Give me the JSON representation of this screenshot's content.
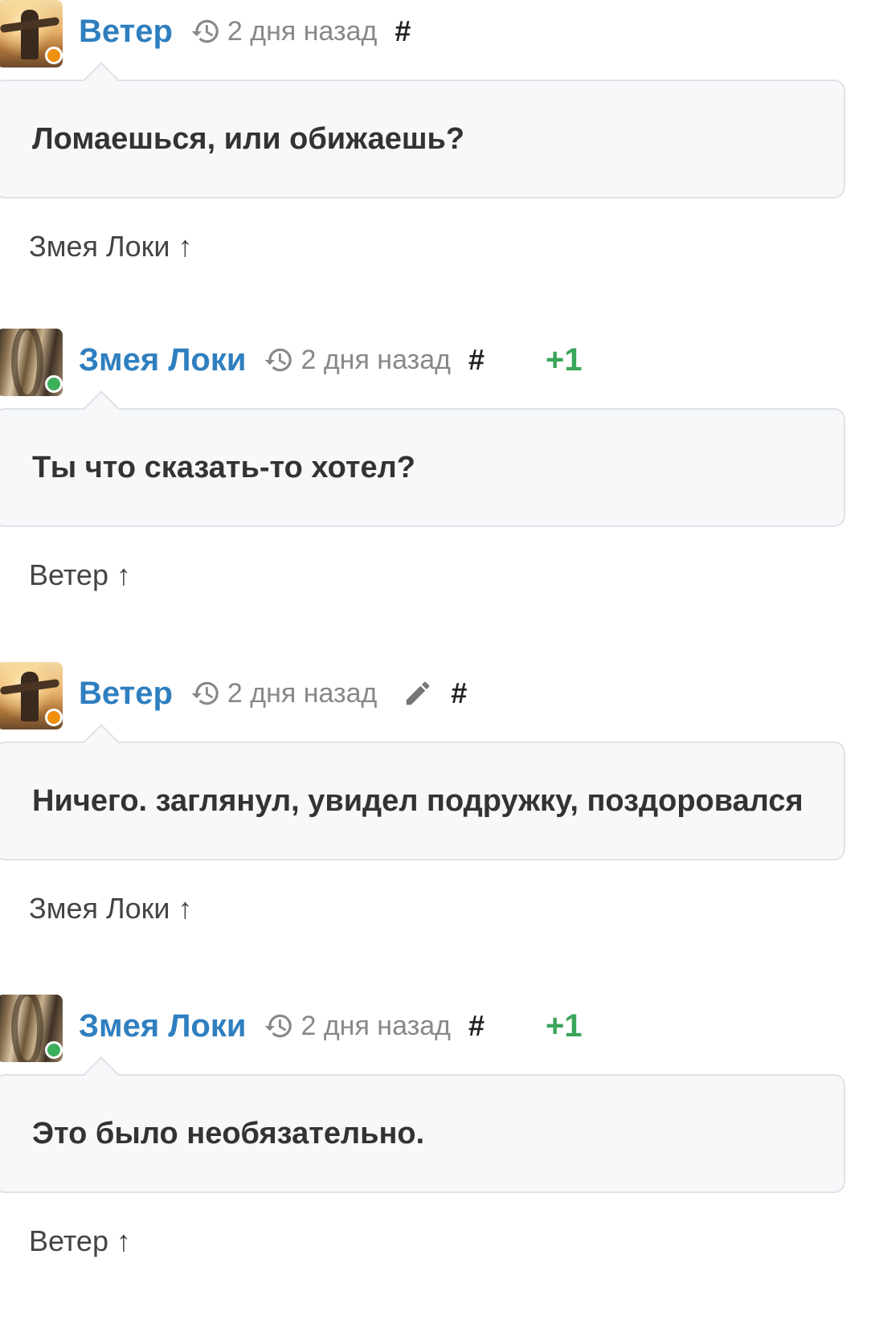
{
  "colors": {
    "author_link": "#2f7fbf",
    "vote_positive": "#3aa65a",
    "status_away": "#f0900f",
    "status_online": "#3cae5c",
    "bubble_bg": "#f7f8fa",
    "bubble_border": "#dfe2e6"
  },
  "comments": [
    {
      "author": "Ветер",
      "avatar_icon": "user-avatar-sunset",
      "status": "away",
      "status_color": "#f0900f",
      "time": "2 дня назад",
      "edited": false,
      "permalink": "#",
      "vote": "",
      "text": "Ломаешься, или обижаешь?",
      "reply_to": "Змея Локи ↑"
    },
    {
      "author": "Змея Локи",
      "avatar_icon": "user-avatar-snake",
      "status": "online",
      "status_color": "#3cae5c",
      "time": "2 дня назад",
      "edited": false,
      "permalink": "#",
      "vote": "+1",
      "text": "Ты что сказать-то хотел?",
      "reply_to": "Ветер ↑"
    },
    {
      "author": "Ветер",
      "avatar_icon": "user-avatar-sunset",
      "status": "away",
      "status_color": "#f0900f",
      "time": "2 дня назад",
      "edited": true,
      "permalink": "#",
      "vote": "",
      "text": "Ничего. заглянул, увидел подружку, поздоровался",
      "reply_to": "Змея Локи ↑"
    },
    {
      "author": "Змея Локи",
      "avatar_icon": "user-avatar-snake",
      "status": "online",
      "status_color": "#3cae5c",
      "time": "2 дня назад",
      "edited": false,
      "permalink": "#",
      "vote": "+1",
      "text": "Это было необязательно.",
      "reply_to": "Ветер ↑"
    }
  ]
}
